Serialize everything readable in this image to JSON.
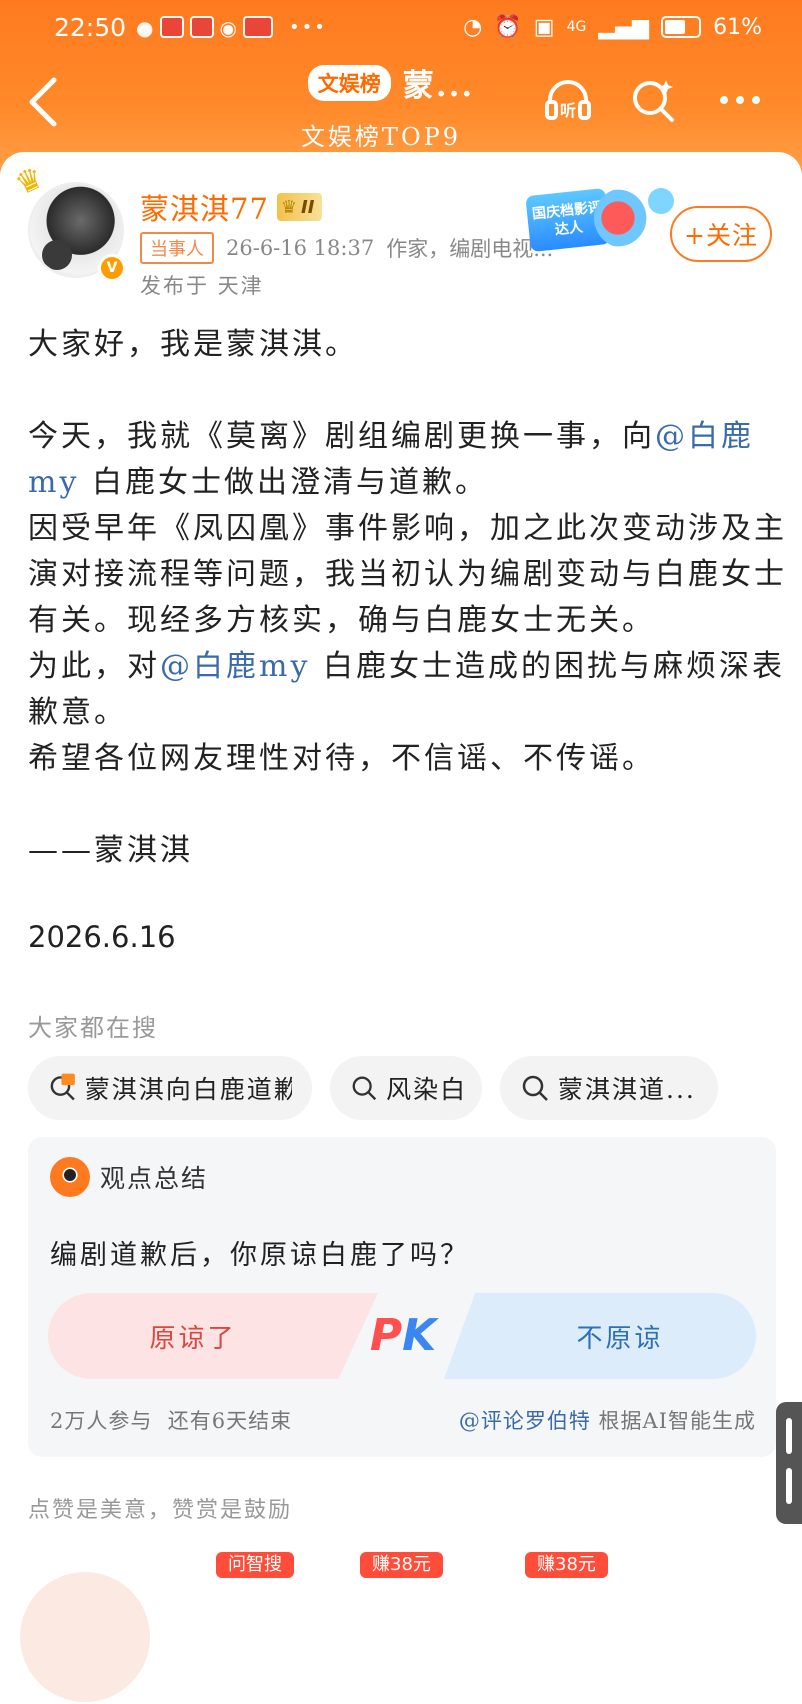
{
  "status_bar": {
    "time": "22:50",
    "battery_text": "61%",
    "battery_level": 0.61,
    "network": "4G"
  },
  "header": {
    "badge": "文娱榜",
    "title": "蒙...",
    "subtitle": "文娱榜TOP9",
    "listen_label": "听"
  },
  "author": {
    "name": "蒙淇淇77",
    "level": "II",
    "tag": "当事人",
    "time": "26-6-16 18:37",
    "bio": "作家，编剧电视...",
    "location": "发布于 天津",
    "award_text": "国庆档影评达人",
    "follow_label": "+关注"
  },
  "post": {
    "p1": "大家好，我是蒙淇淇。",
    "p2a": "今天，我就《莫离》剧组编剧更换一事，向",
    "mention1": "@白鹿my",
    "p2b": " 白鹿女士做出澄清与道歉。",
    "p3": "因受早年《凤囚凰》事件影响，加之此次变动涉及主演对接流程等问题，我当初认为编剧变动与白鹿女士有关。现经多方核实，确与白鹿女士无关。",
    "p4a": "为此，对",
    "mention2": "@白鹿my",
    "p4b": " 白鹿女士造成的困扰与麻烦深表歉意。",
    "p5": "希望各位网友理性对待，不信谣、不传谣。",
    "signature": "——蒙淇淇",
    "date": "2026.6.16"
  },
  "search": {
    "label": "大家都在搜",
    "items": [
      "蒙淇淇向白鹿道歉",
      "风染白",
      "蒙淇淇道..."
    ]
  },
  "opinion": {
    "title": "观点总结",
    "question": "编剧道歉后，你原谅白鹿了吗？",
    "option_left": "原谅了",
    "option_right": "不原谅",
    "pk_p": "P",
    "pk_k": "K",
    "participants": "2万人参与",
    "remaining": "还有6天结束",
    "source_handle": "@评论罗伯特",
    "source_suffix": "根据AI智能生成"
  },
  "praise": {
    "label": "点赞是美意，赞赏是鼓励",
    "tags": [
      "问智搜",
      "赚38元",
      "赚38元"
    ]
  },
  "colors": {
    "brand_orange": "#ff7a1f",
    "mention_blue": "#3a6aa8",
    "pk_red": "#d9473f",
    "pk_blue": "#2f6fb5"
  }
}
